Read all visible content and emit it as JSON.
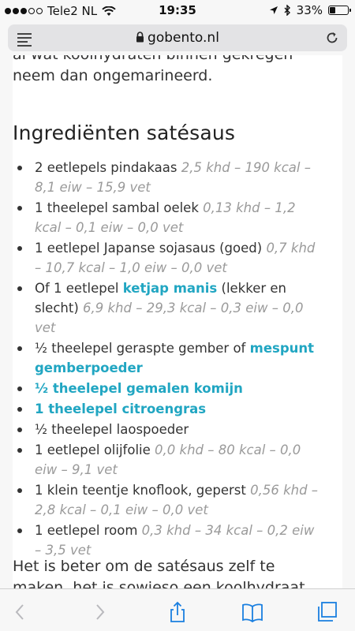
{
  "status": {
    "carrier": "Tele2 NL",
    "time": "19:35",
    "battery": "33%",
    "battery_level": 0.33
  },
  "address": {
    "url": "gobento.nl"
  },
  "article": {
    "intro_line1": "al wat koolhydraten binnen gekregen",
    "intro_line2": "neem dan ongemarineerd.",
    "heading": "Ingrediënten satésaus",
    "ingredients": [
      {
        "text": "2 eetlepels pindakaas ",
        "nutrition": "2,5 khd – 190 kcal – 8,1 eiw – 15,9 vet"
      },
      {
        "text": "1 theelepel sambal oelek ",
        "nutrition": "0,13 khd – 1,2 kcal – 0,1 eiw – 0,0 vet"
      },
      {
        "text": "1 eetlepel Japanse sojasaus (goed) ",
        "nutrition": "0,7 khd – 10,7 kcal – 1,0 eiw – 0,0 vet"
      },
      {
        "prefix": "Of 1 eetlepel ",
        "link": "ketjap manis",
        "suffix": " (lekker en slecht) ",
        "nutrition": "6,9 khd – 29,3 kcal – 0,3 eiw – 0,0 vet"
      },
      {
        "prefix": "½ theelepel geraspte gember of ",
        "link": "mespunt gemberpoeder"
      },
      {
        "link": "½ theelepel gemalen komijn"
      },
      {
        "link": "1 theelepel citroengras"
      },
      {
        "text": "½ theelepel laospoeder"
      },
      {
        "text": "1 eetlepel olijfolie ",
        "nutrition": "0,0 khd – 80 kcal – 0,0 eiw – 9,1 vet"
      },
      {
        "text": "1 klein teentje knoflook, geperst ",
        "nutrition": "0,56 khd – 2,8 kcal – 0,1 eiw – 0,0 vet"
      },
      {
        "text": "1 eetlepel room ",
        "nutrition": "0,3 khd – 34 kcal – 0,2 eiw – 3,5 vet"
      }
    ],
    "outro": "Het is beter om de satésaus zelf te maken, het is sowieso een koolhydraat"
  },
  "toolbar": {
    "icons": [
      "back-icon",
      "forward-icon",
      "share-icon",
      "bookmarks-icon",
      "tabs-icon"
    ]
  },
  "colors": {
    "link": "#21a6c2",
    "nutrition": "#9a9a9a"
  }
}
